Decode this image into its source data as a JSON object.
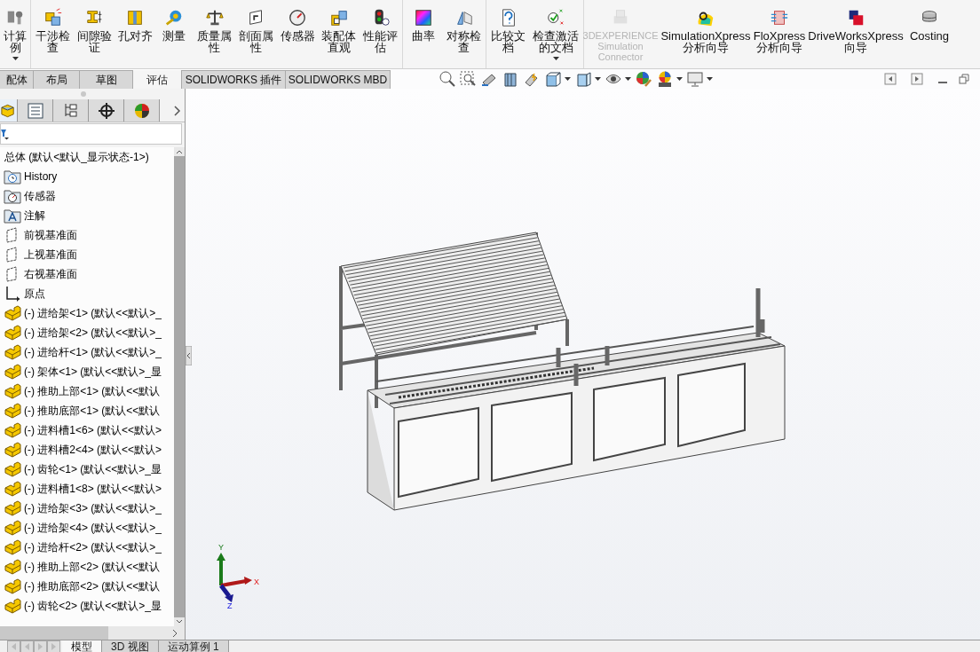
{
  "ribbon": {
    "groups": [
      {
        "buttons": [
          {
            "label": "计算例",
            "disabled": false,
            "dropdown": true
          }
        ]
      },
      {
        "buttons": [
          {
            "label": "干涉检查",
            "disabled": false,
            "dropdown": false
          },
          {
            "label": "间隙验证",
            "disabled": false,
            "dropdown": false
          },
          {
            "label": "孔对齐",
            "disabled": false,
            "dropdown": false
          },
          {
            "label": "测量",
            "disabled": false,
            "dropdown": false
          },
          {
            "label": "质量属性",
            "disabled": false,
            "dropdown": false
          },
          {
            "label": "剖面属性",
            "disabled": false,
            "dropdown": false
          },
          {
            "label": "传感器",
            "disabled": false,
            "dropdown": false
          },
          {
            "label": "装配体直观",
            "disabled": false,
            "dropdown": false
          },
          {
            "label": "性能评估",
            "disabled": false,
            "dropdown": false
          }
        ]
      },
      {
        "buttons": [
          {
            "label": "曲率",
            "disabled": false,
            "dropdown": false
          },
          {
            "label": "对称检查",
            "disabled": false,
            "dropdown": false
          }
        ]
      },
      {
        "buttons": [
          {
            "label": "比较文档",
            "disabled": false,
            "dropdown": false
          },
          {
            "label": "检查激活的文档",
            "disabled": false,
            "dropdown": true
          }
        ]
      },
      {
        "buttons": [
          {
            "label": "3DEXPERIENCE Simulation Connector",
            "disabled": true,
            "dropdown": false
          },
          {
            "label": "SimulationXpress 分析向导",
            "disabled": false,
            "dropdown": false
          },
          {
            "label": "FloXpress 分析向导",
            "disabled": false,
            "dropdown": false
          },
          {
            "label": "DriveWorksXpress 向导",
            "disabled": false,
            "dropdown": false
          },
          {
            "label": "Costing",
            "disabled": false,
            "dropdown": false
          }
        ]
      }
    ]
  },
  "command_tabs": [
    {
      "label": "配体",
      "selected": false
    },
    {
      "label": "布局",
      "selected": false
    },
    {
      "label": "草图",
      "selected": false
    },
    {
      "label": "评估",
      "selected": true
    },
    {
      "label": "SOLIDWORKS 插件",
      "selected": false
    },
    {
      "label": "SOLIDWORKS MBD",
      "selected": false
    }
  ],
  "feature_tree": {
    "root": "总体 (默认<默认_显示状态-1>)",
    "items": [
      {
        "kind": "history",
        "label": "History"
      },
      {
        "kind": "sensors",
        "label": "传感器"
      },
      {
        "kind": "annotations",
        "label": "注解"
      },
      {
        "kind": "plane",
        "label": "前视基准面"
      },
      {
        "kind": "plane",
        "label": "上视基准面"
      },
      {
        "kind": "plane",
        "label": "右视基准面"
      },
      {
        "kind": "origin",
        "label": "原点"
      },
      {
        "kind": "part",
        "label": "(-) 进给架<1> (默认<<默认>_"
      },
      {
        "kind": "part",
        "label": "(-) 进给架<2> (默认<<默认>_"
      },
      {
        "kind": "part",
        "label": "(-) 进给杆<1> (默认<<默认>_"
      },
      {
        "kind": "part",
        "label": "(-) 架体<1> (默认<<默认>_显"
      },
      {
        "kind": "part",
        "label": "(-) 推助上部<1> (默认<<默认"
      },
      {
        "kind": "part",
        "label": "(-) 推助底部<1> (默认<<默认"
      },
      {
        "kind": "part",
        "label": "(-) 进料槽1<6> (默认<<默认>"
      },
      {
        "kind": "part",
        "label": "(-) 进料槽2<4> (默认<<默认>"
      },
      {
        "kind": "part",
        "label": "(-) 齿轮<1> (默认<<默认>_显"
      },
      {
        "kind": "part",
        "label": "(-) 进料槽1<8> (默认<<默认>"
      },
      {
        "kind": "part",
        "label": "(-) 进给架<3> (默认<<默认>_"
      },
      {
        "kind": "part",
        "label": "(-) 进给架<4> (默认<<默认>_"
      },
      {
        "kind": "part",
        "label": "(-) 进给杆<2> (默认<<默认>_"
      },
      {
        "kind": "part",
        "label": "(-) 推助上部<2> (默认<<默认"
      },
      {
        "kind": "part",
        "label": "(-) 推助底部<2> (默认<<默认"
      },
      {
        "kind": "part",
        "label": "(-) 齿轮<2> (默认<<默认>_显"
      }
    ]
  },
  "panel_tabs": [
    {
      "selected": true
    },
    {
      "selected": false
    },
    {
      "selected": false
    },
    {
      "selected": false
    },
    {
      "selected": false
    }
  ],
  "triad": {
    "x": "X",
    "y": "Y",
    "z": "Z"
  },
  "bottom_tabs": [
    {
      "label": "模型",
      "selected": true
    },
    {
      "label": "3D 视图",
      "selected": false
    },
    {
      "label": "运动算例 1",
      "selected": false
    }
  ]
}
